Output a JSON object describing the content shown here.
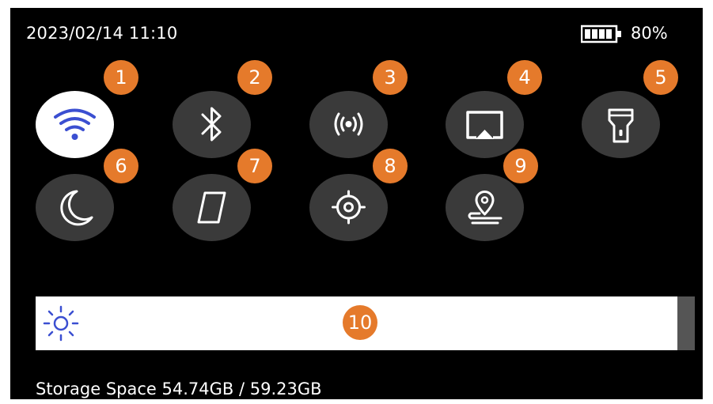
{
  "status_bar": {
    "time": "2023/02/14 11:10",
    "battery_percent": "80%",
    "battery_icon": "battery-icon",
    "battery_level": 0.8
  },
  "quick_settings": [
    {
      "id": "wifi",
      "icon": "wifi-icon",
      "badge": "1",
      "active": true
    },
    {
      "id": "bluetooth",
      "icon": "bluetooth-icon",
      "badge": "2",
      "active": false
    },
    {
      "id": "hotspot",
      "icon": "hotspot-icon",
      "badge": "3",
      "active": false
    },
    {
      "id": "screen-cast",
      "icon": "cast-icon",
      "badge": "4",
      "active": false
    },
    {
      "id": "flashlight",
      "icon": "flashlight-icon",
      "badge": "5",
      "active": false
    },
    {
      "id": "night-mode",
      "icon": "moon-icon",
      "badge": "6",
      "active": false
    },
    {
      "id": "compass",
      "icon": "compass-icon",
      "badge": "7",
      "active": false
    },
    {
      "id": "gps",
      "icon": "target-icon",
      "badge": "8",
      "active": false
    },
    {
      "id": "location",
      "icon": "location-pin-icon",
      "badge": "9",
      "active": false
    }
  ],
  "brightness": {
    "icon": "sun-icon",
    "badge": "10"
  },
  "storage": {
    "text": "Storage Space 54.74GB / 59.23GB"
  },
  "colors": {
    "background": "#000000",
    "tile": "#3a3a3a",
    "tile_active": "#ffffff",
    "badge": "#e57a2b",
    "icon_active": "#3b4fd1",
    "icon": "#ffffff"
  }
}
